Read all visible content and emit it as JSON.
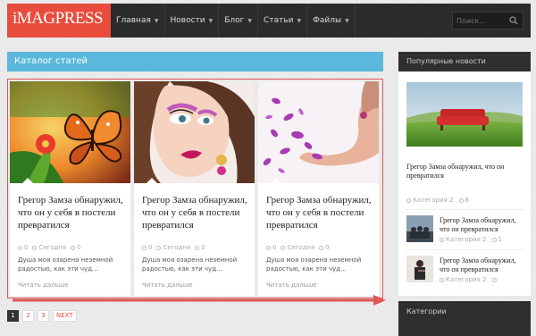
{
  "header": {
    "logo": "iMAGPRESS",
    "nav": [
      {
        "label": "Главная"
      },
      {
        "label": "Новости"
      },
      {
        "label": "Блог"
      },
      {
        "label": "Статьи"
      },
      {
        "label": "Файлы"
      }
    ],
    "search_placeholder": "Поиск..."
  },
  "catalog": {
    "title": "Каталог статей",
    "cards": [
      {
        "title": "Грегор Замза обнаружил, что он у себя в постели превратился",
        "comments": "0",
        "date": "Сегодня",
        "views": "0",
        "excerpt": "Душа моя озарена неземной радостью, как эти чуд...",
        "more": "Читать дальше"
      },
      {
        "title": "Грегор Замза обнаружил, что он у себя в постели превратился",
        "comments": "0",
        "date": "Сегодня",
        "views": "0",
        "excerpt": "Душа моя озарена неземной радостью, как эти чуд...",
        "more": "Читать дальше"
      },
      {
        "title": "Грегор Замза обнаружил, что он у себя в постели превратился",
        "comments": "0",
        "date": "Сегодня",
        "views": "0",
        "excerpt": "Душа моя озарена неземной радостью, как эти чуд...",
        "more": "Читать дальше"
      }
    ]
  },
  "pagination": {
    "pages": [
      "1",
      "2",
      "3"
    ],
    "next": "NEXT"
  },
  "sidebar": {
    "popular_title": "Популярные новости",
    "featured": {
      "title": "Грегор Замза обнаружил, что он превратился",
      "category": "Категория 2",
      "count": "6"
    },
    "items": [
      {
        "title": "Грегор Замза обнаружил, что он превратился",
        "category": "Категория 2",
        "count": "1"
      },
      {
        "title": "Грегор Замза обнаружил, что он превратился",
        "category": "Категория 2",
        "count": ""
      }
    ],
    "categories_title": "Категории"
  },
  "colors": {
    "logo_bg": "#e74c3c",
    "catalog_bar": "#5bb8dc",
    "topbar": "#2b2b2b",
    "highlight": "#e05555"
  }
}
